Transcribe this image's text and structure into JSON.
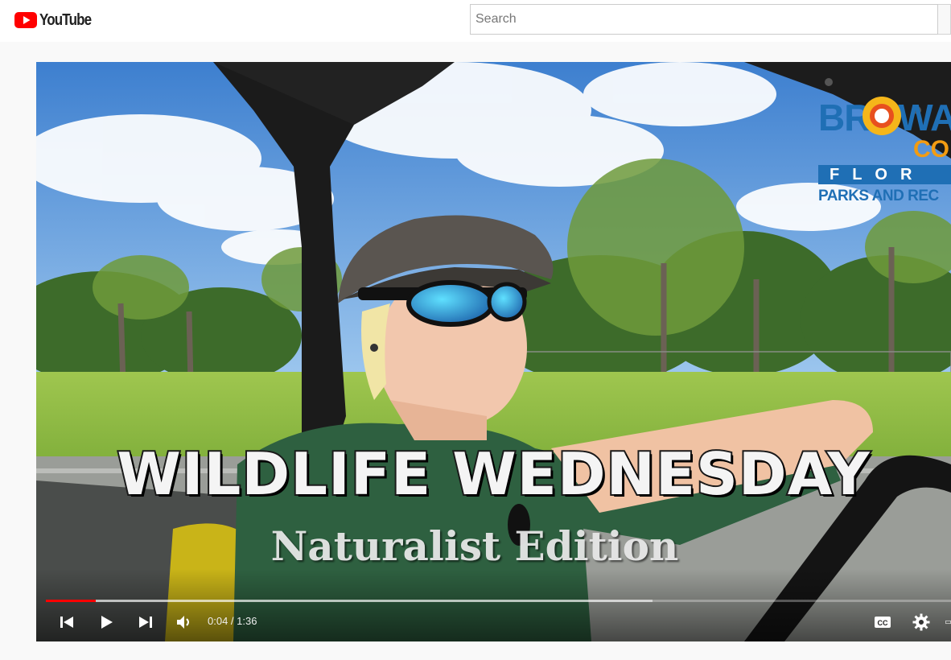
{
  "masthead": {
    "logo_text": "YouTube",
    "logo_color": "#ff0000",
    "search": {
      "placeholder": "Search",
      "value": ""
    }
  },
  "video": {
    "overlay": {
      "title": "WILDLIFE WEDNESDAY",
      "subtitle": "Naturalist Edition",
      "brand_name": "BROWA",
      "brand_county": "CO",
      "brand_state": "FLOR",
      "brand_dept": "PARKS AND REC"
    },
    "controls": {
      "current_time": "0:04",
      "separator": " / ",
      "duration": "1:36",
      "played_fraction": 0.055,
      "buffered_fraction": 0.67,
      "progress_color": "#ff0000",
      "icons": [
        "skip-previous-icon",
        "play-icon",
        "skip-next-icon",
        "volume-icon",
        "closed-captions-icon",
        "settings-icon"
      ]
    }
  }
}
